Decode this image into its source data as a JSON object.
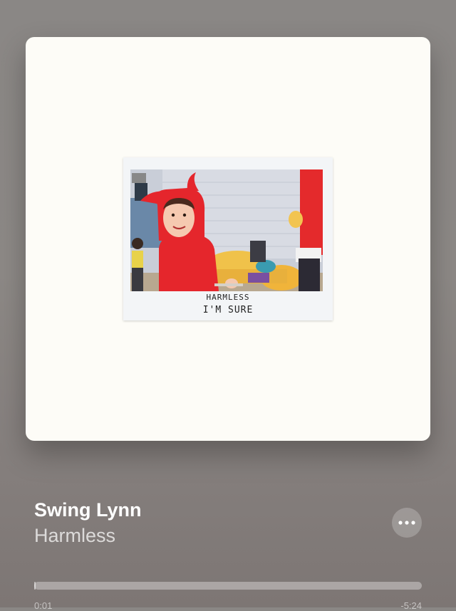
{
  "album": {
    "cover_text_line1": "HARMLESS",
    "cover_text_line2": "I'M SURE"
  },
  "track": {
    "title": "Swing Lynn",
    "artist": "Harmless"
  },
  "more_button": {
    "icon": "ellipsis-icon"
  },
  "playback": {
    "elapsed": "0:01",
    "remaining": "-5:24",
    "progress_fraction": 0.003
  },
  "colors": {
    "background": "#8a8785",
    "artwork_bg": "#fdfcf7",
    "hoodie_red": "#e5262c"
  }
}
